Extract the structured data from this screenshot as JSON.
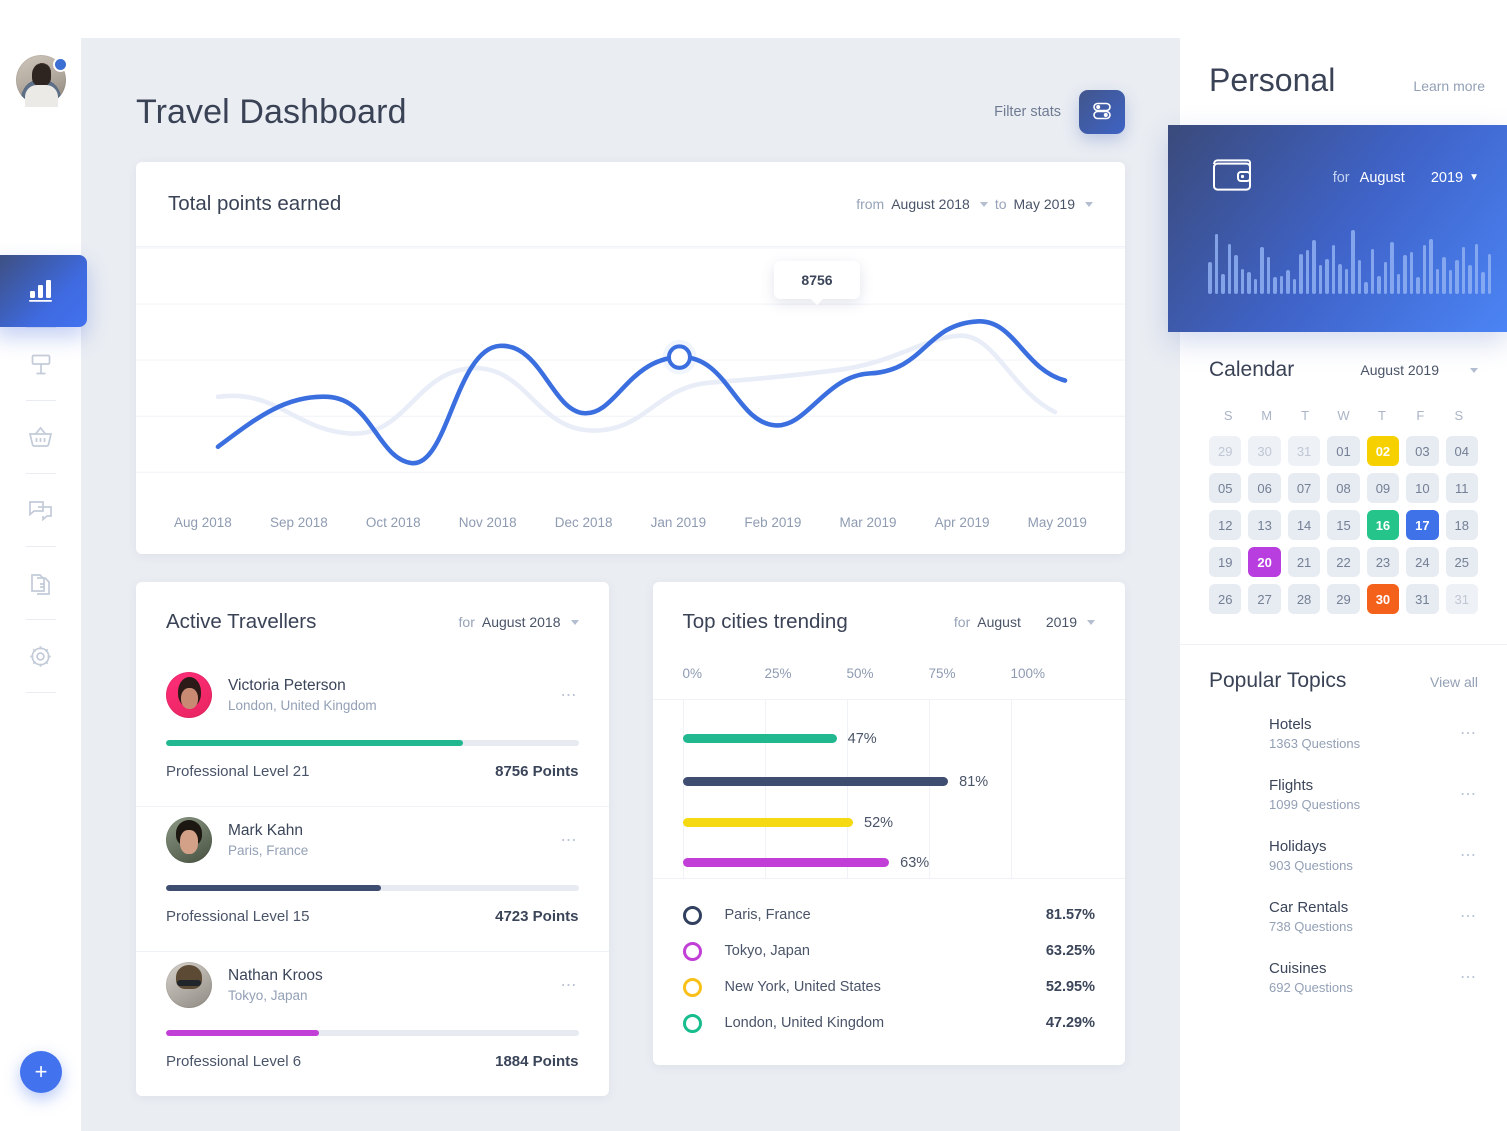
{
  "sidebar": {
    "avatar_name": "user-avatar",
    "items": [
      {
        "name": "analytics",
        "icon": "bar-chart-icon",
        "active": true
      },
      {
        "name": "places",
        "icon": "signpost-icon",
        "active": false
      },
      {
        "name": "shop",
        "icon": "basket-icon",
        "active": false
      },
      {
        "name": "messages",
        "icon": "chat-icon",
        "active": false
      },
      {
        "name": "documents",
        "icon": "documents-icon",
        "active": false
      },
      {
        "name": "settings",
        "icon": "gear-icon",
        "active": false
      }
    ],
    "add_label": "+"
  },
  "header": {
    "title": "Travel Dashboard",
    "filter_label": "Filter stats",
    "filter_icon": "sliders-icon"
  },
  "chart_card": {
    "title": "Total points earned",
    "from_label": "from",
    "from_value": "August 2018",
    "to_label": "to",
    "to_value": "May 2019",
    "tooltip_value": "8756"
  },
  "chart_data": {
    "type": "line",
    "title": "Total points earned",
    "xlabel": "",
    "ylabel": "",
    "grid": true,
    "legend": "none",
    "categories": [
      "Aug 2018",
      "Sep 2018",
      "Oct 2018",
      "Nov 2018",
      "Dec 2018",
      "Jan 2019",
      "Feb 2019",
      "Mar 2019",
      "Apr 2019",
      "May 2019"
    ],
    "highlight": {
      "category": "Jan 2019",
      "value": 8756
    },
    "series": [
      {
        "name": "Points earned",
        "color": "#3b6fe0",
        "values": [
          2100,
          5200,
          2600,
          7100,
          4600,
          8756,
          4300,
          7400,
          8900,
          5600
        ]
      },
      {
        "name": "Previous period",
        "color": "#e8edf7",
        "values": [
          5100,
          4300,
          3600,
          5500,
          6400,
          4400,
          6600,
          6300,
          7300,
          4900
        ]
      }
    ]
  },
  "travellers_card": {
    "title": "Active Travellers",
    "for_label": "for",
    "period": "August 2018",
    "menu_icon": "more-icon",
    "items": [
      {
        "name": "Victoria Peterson",
        "location": "London, United Kingdom",
        "level": "Professional Level 21",
        "points": "8756 Points",
        "progress": 72,
        "color": "#21b890",
        "avatar": "a"
      },
      {
        "name": "Mark Kahn",
        "location": "Paris, France",
        "level": "Professional Level 15",
        "points": "4723 Points",
        "progress": 52,
        "color": "#3e4d70",
        "avatar": "b"
      },
      {
        "name": "Nathan Kroos",
        "location": "Tokyo, Japan",
        "level": "Professional Level 6",
        "points": "1884 Points",
        "progress": 37,
        "color": "#c13fd6",
        "avatar": "c"
      }
    ]
  },
  "cities_card": {
    "title": "Top cities trending",
    "for_label": "for",
    "month": "August",
    "year": "2019"
  },
  "cities_chart": {
    "type": "bar",
    "orientation": "horizontal",
    "title": "Top cities trending",
    "xlabel": "",
    "ylabel": "",
    "xlim": [
      0,
      100
    ],
    "tick_labels": [
      "0%",
      "25%",
      "50%",
      "75%",
      "100%"
    ],
    "grid": true,
    "categories": [
      "London, United Kingdom",
      "Paris, France",
      "New York, United States",
      "Tokyo, Japan"
    ],
    "values": [
      47,
      81,
      52,
      63
    ],
    "bar_labels": [
      "47%",
      "81%",
      "52%",
      "63%"
    ],
    "colors": [
      "#21b890",
      "#3e4d70",
      "#f5d912",
      "#c13fd6"
    ],
    "legend": [
      {
        "label": "Paris, France",
        "value": "81.57%",
        "color": "#32405f"
      },
      {
        "label": "Tokyo, Japan",
        "value": "63.25%",
        "color": "#c13fd6"
      },
      {
        "label": "New York, United States",
        "value": "52.95%",
        "color": "#f9c01a"
      },
      {
        "label": "London, United Kingdom",
        "value": "47.29%",
        "color": "#17bd8d"
      }
    ]
  },
  "right_panel": {
    "title": "Personal",
    "learn_more": "Learn more",
    "wallet": {
      "icon": "wallet-icon",
      "for_label": "for",
      "month": "August",
      "year": "2019",
      "bars": [
        38,
        72,
        24,
        60,
        46,
        30,
        26,
        18,
        56,
        44,
        20,
        22,
        28,
        18,
        48,
        52,
        64,
        34,
        42,
        58,
        36,
        30,
        76,
        40,
        14,
        54,
        22,
        38,
        62,
        24,
        46,
        50,
        20,
        58,
        66,
        30,
        44,
        28,
        40,
        56,
        34,
        60,
        26,
        48
      ]
    },
    "calendar": {
      "title": "Calendar",
      "period": "August 2019",
      "dow": [
        "S",
        "M",
        "T",
        "W",
        "T",
        "F",
        "S"
      ],
      "days": [
        {
          "label": "29",
          "state": "muted"
        },
        {
          "label": "30",
          "state": "muted"
        },
        {
          "label": "31",
          "state": "muted"
        },
        {
          "label": "01",
          "state": "normal"
        },
        {
          "label": "02",
          "state": "sel",
          "color": "#f7d000"
        },
        {
          "label": "03",
          "state": "normal"
        },
        {
          "label": "04",
          "state": "normal"
        },
        {
          "label": "05",
          "state": "normal"
        },
        {
          "label": "06",
          "state": "normal"
        },
        {
          "label": "07",
          "state": "normal"
        },
        {
          "label": "08",
          "state": "normal"
        },
        {
          "label": "09",
          "state": "normal"
        },
        {
          "label": "10",
          "state": "normal"
        },
        {
          "label": "11",
          "state": "normal"
        },
        {
          "label": "12",
          "state": "normal"
        },
        {
          "label": "13",
          "state": "normal"
        },
        {
          "label": "14",
          "state": "normal"
        },
        {
          "label": "15",
          "state": "normal"
        },
        {
          "label": "16",
          "state": "sel",
          "color": "#25c48a"
        },
        {
          "label": "17",
          "state": "sel",
          "color": "#3f72e8"
        },
        {
          "label": "18",
          "state": "normal"
        },
        {
          "label": "19",
          "state": "normal"
        },
        {
          "label": "20",
          "state": "sel",
          "color": "#b93ee0"
        },
        {
          "label": "21",
          "state": "normal"
        },
        {
          "label": "22",
          "state": "normal"
        },
        {
          "label": "23",
          "state": "normal"
        },
        {
          "label": "24",
          "state": "normal"
        },
        {
          "label": "25",
          "state": "normal"
        },
        {
          "label": "26",
          "state": "normal"
        },
        {
          "label": "27",
          "state": "normal"
        },
        {
          "label": "28",
          "state": "normal"
        },
        {
          "label": "29",
          "state": "normal"
        },
        {
          "label": "30",
          "state": "sel",
          "color": "#f4611b"
        },
        {
          "label": "31",
          "state": "normal"
        },
        {
          "label": "31",
          "state": "muted"
        }
      ]
    },
    "topics": {
      "title": "Popular Topics",
      "view_all": "View all",
      "items": [
        {
          "label": "Hotels",
          "questions": "1363 Questions",
          "color": "#b55cf0",
          "icon": "hotel-icon"
        },
        {
          "label": "Flights",
          "questions": "1099 Questions",
          "color": "#29c68f",
          "icon": "plane-icon"
        },
        {
          "label": "Holidays",
          "questions": "903 Questions",
          "color": "#f7d000",
          "icon": "balloon-icon"
        },
        {
          "label": "Car Rentals",
          "questions": "738 Questions",
          "color": "#3f72e8",
          "icon": "car-icon"
        },
        {
          "label": "Cuisines",
          "questions": "692 Questions",
          "color": "#f4611b",
          "icon": "food-icon"
        }
      ]
    }
  }
}
